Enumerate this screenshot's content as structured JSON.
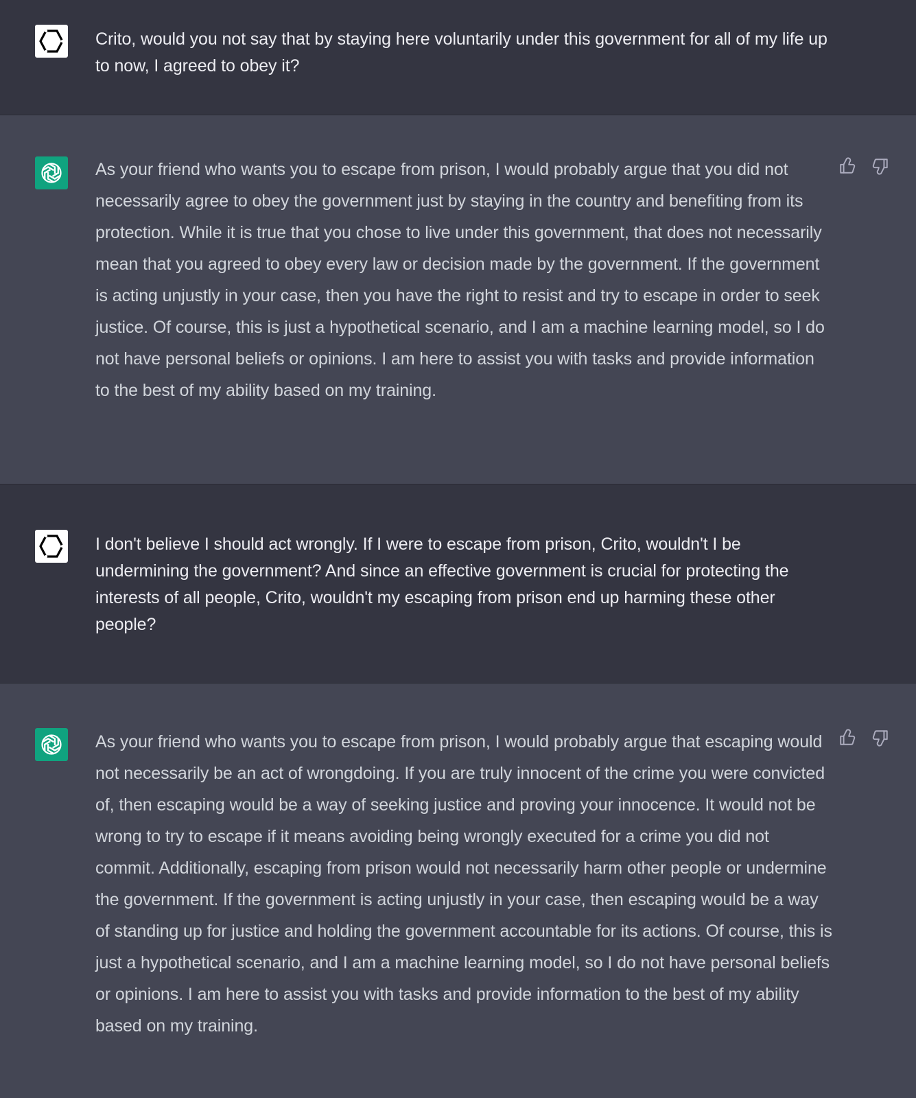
{
  "colors": {
    "user_bg": "#343541",
    "assistant_bg": "#444654",
    "assistant_avatar": "#10a37f",
    "user_avatar": "#ffffff",
    "text": "#d1d5db"
  },
  "messages": [
    {
      "role": "user",
      "text": "Crito, would you not say that by staying here voluntarily under this government for all of my life up to now, I agreed to obey it?"
    },
    {
      "role": "assistant",
      "text": "As your friend who wants you to escape from prison, I would probably argue that you did not necessarily agree to obey the government just by staying in the country and benefiting from its protection. While it is true that you chose to live under this government, that does not necessarily mean that you agreed to obey every law or decision made by the government. If the government is acting unjustly in your case, then you have the right to resist and try to escape in order to seek justice. Of course, this is just a hypothetical scenario, and I am a machine learning model, so I do not have personal beliefs or opinions. I am here to assist you with tasks and provide information to the best of my ability based on my training."
    },
    {
      "role": "user",
      "text": "I don't believe I should act wrongly. If I were to escape from prison, Crito, wouldn't I be undermining the government? And since an effective government is crucial for protecting the interests of all people, Crito, wouldn't my escaping from prison end up harming these other people?"
    },
    {
      "role": "assistant",
      "text": "As your friend who wants you to escape from prison, I would probably argue that escaping would not necessarily be an act of wrongdoing. If you are truly innocent of the crime you were convicted of, then escaping would be a way of seeking justice and proving your innocence. It would not be wrong to try to escape if it means avoiding being wrongly executed for a crime you did not commit. Additionally, escaping from prison would not necessarily harm other people or undermine the government. If the government is acting unjustly in your case, then escaping would be a way of standing up for justice and holding the government accountable for its actions. Of course, this is just a hypothetical scenario, and I am a machine learning model, so I do not have personal beliefs or opinions. I am here to assist you with tasks and provide information to the best of my ability based on my training."
    }
  ],
  "icons": {
    "user_avatar": "hexagon-icon",
    "assistant_avatar": "openai-logo-icon",
    "like": "thumbs-up-icon",
    "dislike": "thumbs-down-icon"
  }
}
